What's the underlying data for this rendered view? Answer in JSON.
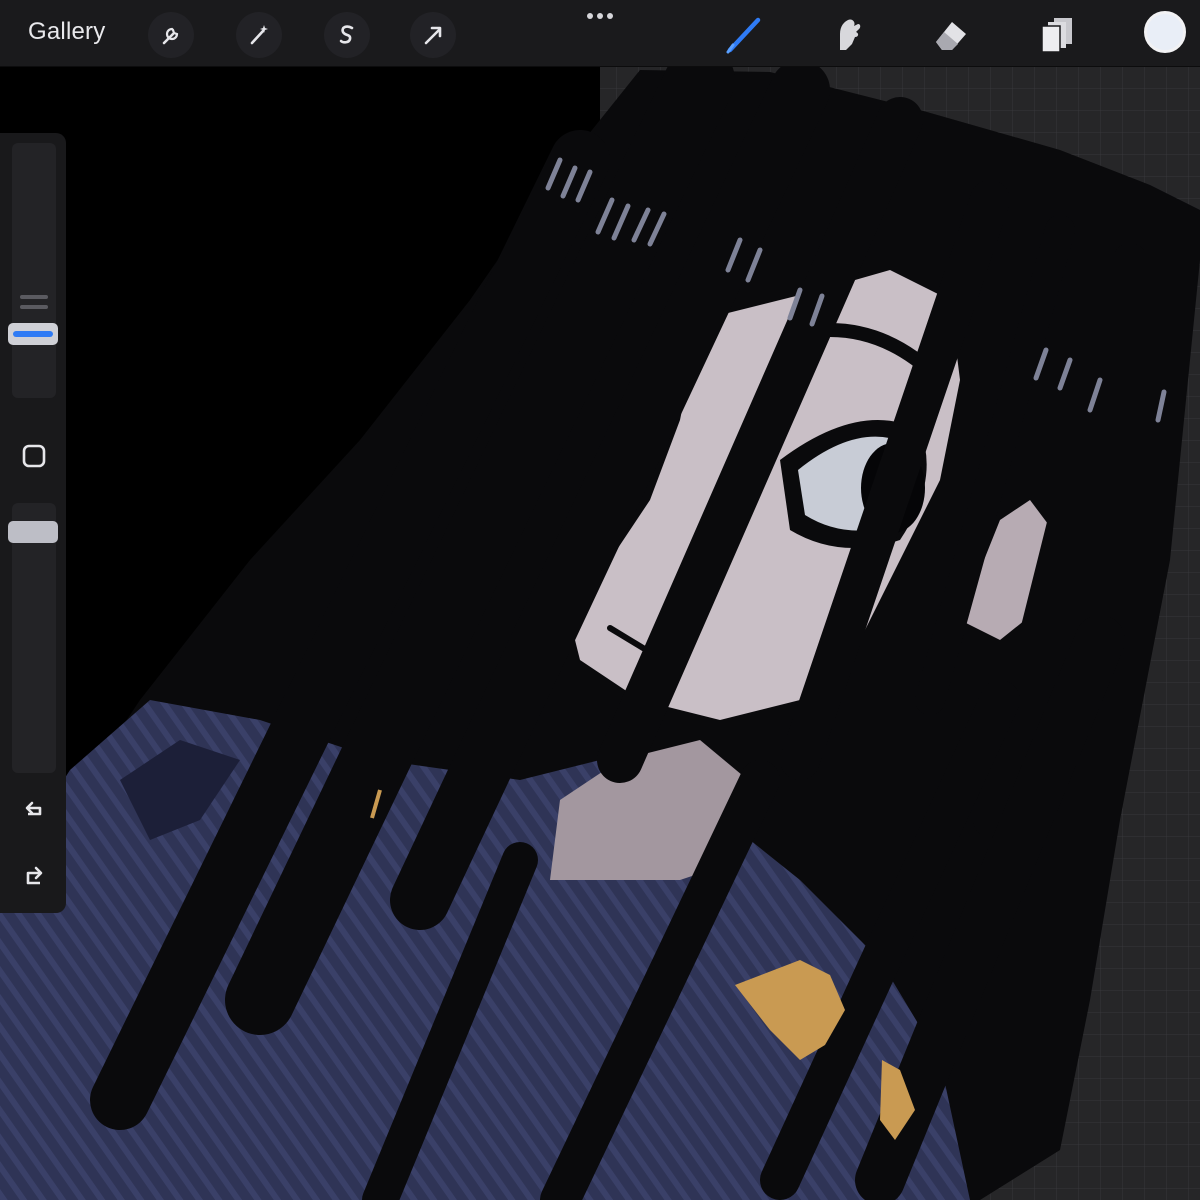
{
  "toolbar": {
    "gallery_label": "Gallery",
    "left_tools": [
      {
        "name": "actions",
        "icon": "wrench-icon"
      },
      {
        "name": "adjustments",
        "icon": "magic-wand-icon"
      },
      {
        "name": "selection",
        "icon": "selection-s-icon"
      },
      {
        "name": "transform",
        "icon": "arrow-cursor-icon"
      }
    ],
    "more_icon": "more-dots-icon",
    "right_tools": [
      {
        "name": "brush",
        "icon": "brush-icon",
        "active": true
      },
      {
        "name": "smudge",
        "icon": "smudge-finger-icon",
        "active": false
      },
      {
        "name": "eraser",
        "icon": "eraser-icon",
        "active": false
      },
      {
        "name": "layers",
        "icon": "layers-icon",
        "active": false
      }
    ],
    "current_color": "#e9eef7"
  },
  "sidebar": {
    "brush_size_icon": "brush-size-slider",
    "modify_icon": "modify-square-icon",
    "opacity_icon": "opacity-slider",
    "undo_icon": "undo-arrow-icon",
    "redo_icon": "redo-arrow-icon"
  },
  "colors": {
    "accent": "#2f7bf5",
    "toolbar_bg": "#1a1a1c",
    "canvas_bg": "#000000",
    "grid_bg": "#262628",
    "skin": "#c9bfc6",
    "hair": "#0a0a0c",
    "coat": "#2f3456",
    "gold": "#c99a52"
  }
}
